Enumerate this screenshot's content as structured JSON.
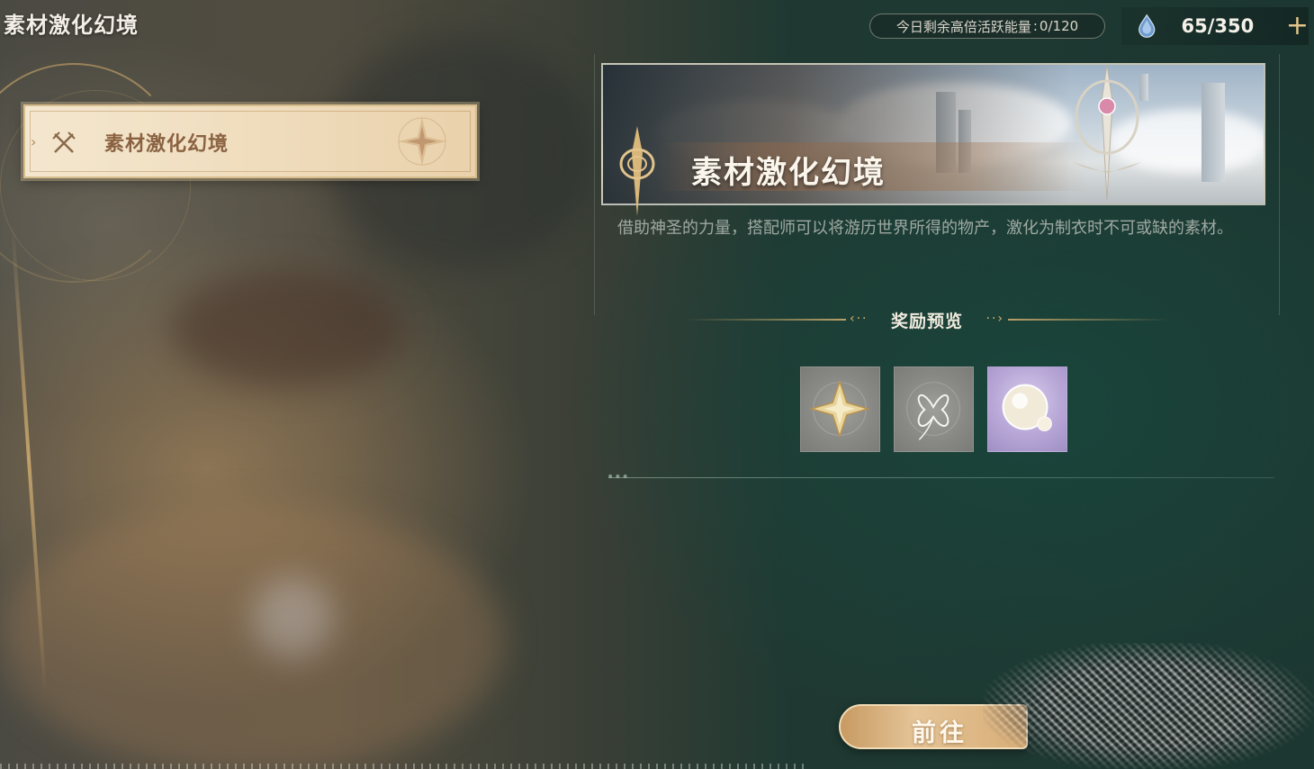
{
  "header": {
    "page_title": "素材激化幻境",
    "energy_label": "今日剩余高倍活跃能量",
    "energy_separator": ":",
    "energy_value": "0/120",
    "currency_value": "65/350",
    "currency_icon": "crystal-drop-icon",
    "add_label": "+"
  },
  "menu": {
    "items": [
      {
        "label": "素材激化幻境",
        "icon": "crossed-swords-icon",
        "selected": true
      }
    ]
  },
  "detail": {
    "banner_title": "素材激化幻境",
    "description": "借助神圣的力量，搭配师可以将游历世界所得的物产，激化为制衣时不可或缺的素材。",
    "rewards_title": "奖励预览",
    "rewards": [
      {
        "icon": "gold-star-flower-icon",
        "rarity_color": "#8a8a87"
      },
      {
        "icon": "silver-thread-icon",
        "rarity_color": "#8a8a87"
      },
      {
        "icon": "pearl-orb-icon",
        "rarity_color": "#b5a4d4"
      }
    ],
    "go_button_label": "前往"
  },
  "colors": {
    "accent_gold": "#d6b06e",
    "panel_teal": "#1c3731",
    "menu_selected_bg": "#f1e1c4"
  }
}
